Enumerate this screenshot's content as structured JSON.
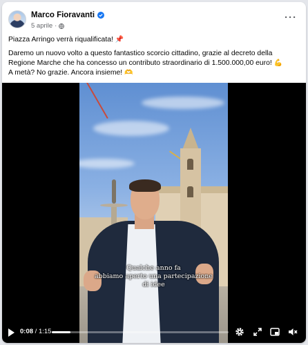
{
  "post": {
    "author": "Marco Fioravanti",
    "date": "5 aprile",
    "separator": "·",
    "more": "···",
    "line1": "Piazza Arringo verrà riqualificata!",
    "line1_emoji": "📌",
    "line2": "Daremo un nuovo volto a questo fantastico scorcio cittadino, grazie al decreto della Regione Marche che ha concesso un contributo straordinario di 1.500.000,00 euro!",
    "line2_emoji": "💪",
    "line3": "A metà? No grazie. Ancora insieme!",
    "line3_emoji": "🫶"
  },
  "video": {
    "subtitle_lines": [
      "Qualche anno fa",
      "abbiamo aperto una partecipazione",
      "di idee"
    ],
    "current_time": "0:08",
    "duration": "1:15",
    "progress_fraction": 0.107
  },
  "icons": {
    "verified": "verified-badge-icon",
    "audience": "globe-icon",
    "play": "play-icon",
    "settings": "gear-icon",
    "fullscreen": "expand-icon",
    "pip": "picture-in-picture-icon",
    "volume": "volume-icon"
  },
  "colors": {
    "verified": "#1877f2",
    "text": "#050505",
    "meta": "#65676b"
  }
}
